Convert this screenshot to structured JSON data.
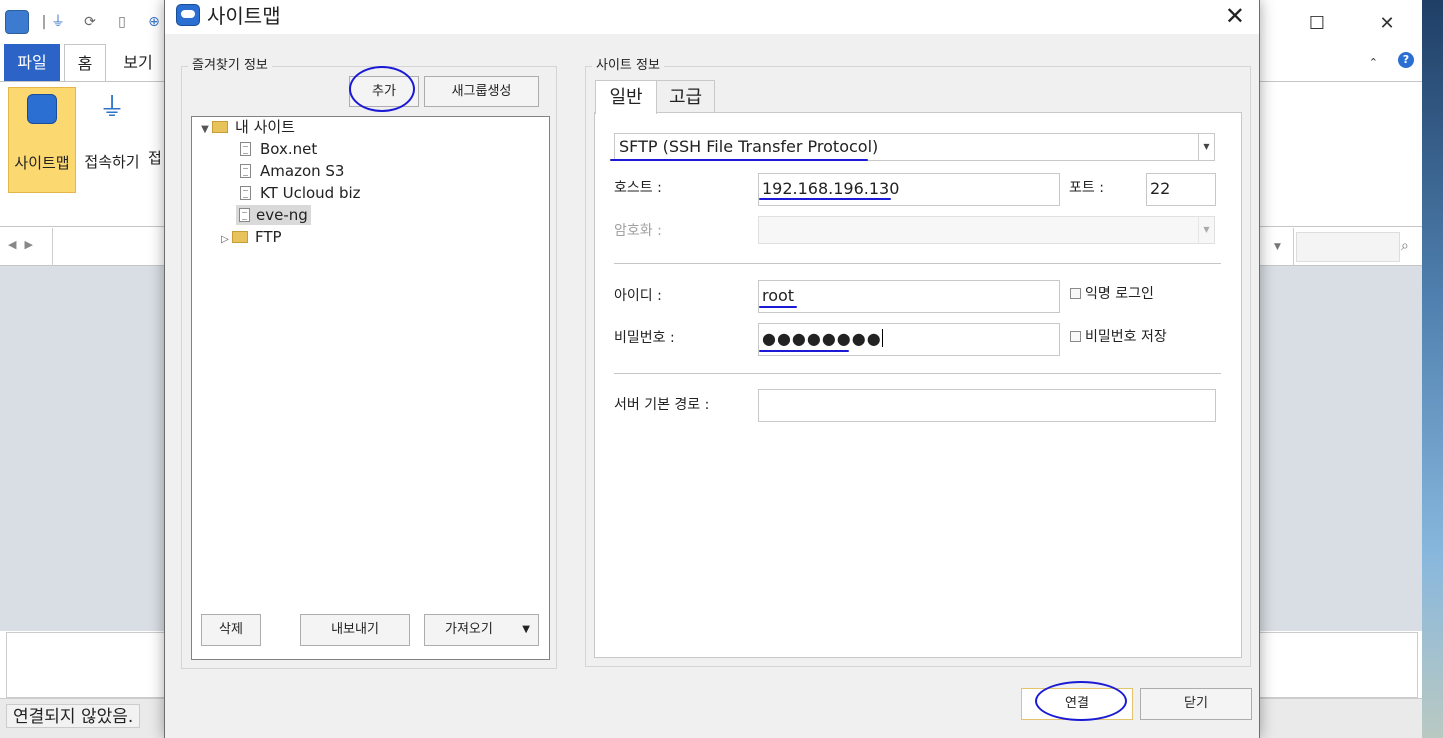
{
  "app": {
    "ribbon_tabs": [
      "파일",
      "홈",
      "보기"
    ],
    "ribbon_buttons": {
      "sitemap": "사이트맵",
      "connect": "접속하기",
      "cut_off": "접"
    },
    "status_text": "연결되지 않았음."
  },
  "dialog": {
    "title": "사이트맵",
    "favorites": {
      "legend": "즐겨찾기 정보",
      "add_button": "추가",
      "new_group_button": "새그룹생성",
      "tree": {
        "root_label": "내 사이트",
        "items": [
          "Box.net",
          "Amazon S3",
          "KT Ucloud biz",
          "eve-ng"
        ],
        "selected": "eve-ng",
        "folder_label": "FTP"
      },
      "delete_button": "삭제",
      "export_button": "내보내기",
      "import_button": "가져오기"
    },
    "site_info": {
      "legend": "사이트 정보",
      "tabs": [
        "일반",
        "고급"
      ],
      "active_tab": "일반",
      "protocol": "SFTP (SSH File Transfer Protocol)",
      "host_label": "호스트 :",
      "host_value": "192.168.196.130",
      "port_label": "포트 :",
      "port_value": "22",
      "encryption_label": "암호화 :",
      "encryption_value": "",
      "id_label": "아이디 :",
      "id_value": "root",
      "anonymous_label": "익명 로그인",
      "password_label": "비밀번호 :",
      "password_value": "●●●●●●●●",
      "save_password_label": "비밀번호 저장",
      "server_path_label": "서버 기본 경로 :",
      "server_path_value": ""
    },
    "connect_button": "연결",
    "close_button": "닫기"
  },
  "colors": {
    "annotation_ink": "#1a1ad6",
    "file_tab": "#2b63c6",
    "selected_ribbon_button": "#fbd870"
  },
  "icons": [
    "app-icon",
    "plug-icon",
    "refresh-icon",
    "folder-icon",
    "document-icon",
    "chevron-down-icon",
    "search-icon",
    "help-icon",
    "close-icon",
    "maximize-icon"
  ]
}
